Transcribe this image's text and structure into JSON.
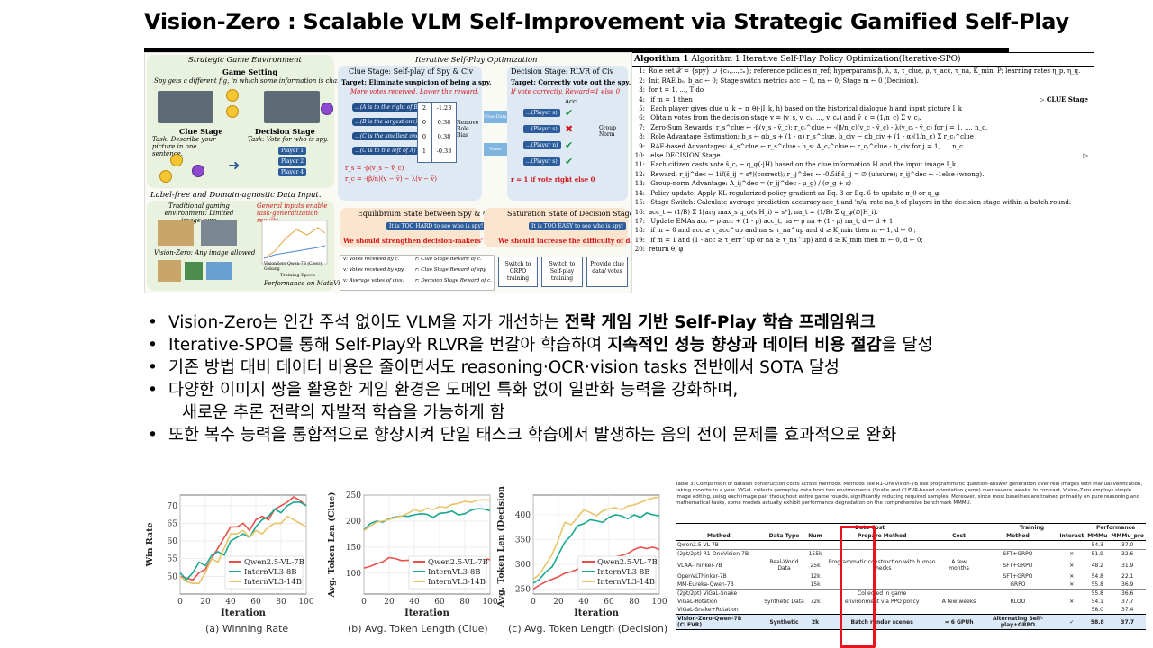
{
  "title": "Vision-Zero : Scalable VLM Self-Improvement via Strategic Gamified Self-Play",
  "framework": {
    "env_title": "Strategic Game Environment",
    "iter_title": "Iterative Self-Play Optimization",
    "game_setting": "Game Setting",
    "game_desc": "Spy gets a different fig, in which some information is changed.",
    "clue_stage_left": "Clue Stage",
    "clue_task": "Task: Describe your picture in one sentence.",
    "decision_stage_left": "Decision Stage",
    "decision_task": "Task: Vote for who is spy.",
    "player1": "Player 1",
    "player2": "Player 2",
    "player4": "Player 4",
    "label_free": "Label-free and Domain-agnostic Data Input.",
    "traditional": "Traditional gaming environment: Limited image type",
    "general": "General inputs enable task-generalization results",
    "any_image": "Vision-Zero: Any image allowed",
    "perf": "Performance on MathVision",
    "training_epoch": "Training Epoch",
    "legend1": "VisionZero-Qwen-7B (Clevr)",
    "legend2": "Gobang",
    "clue_stage_title": "Clue Stage: Self-play of Spy & Civ",
    "clue_target": "Target: Eliminate suspicion of being a spy.",
    "clue_red": "More votes received, Lower the reward.",
    "clues": [
      "...(A is to the right of B)",
      "...(B is the largest one)",
      "...(C is the smallest one)",
      "...(C is to the left of A)"
    ],
    "vc_vals": [
      "2",
      "0",
      "0",
      "1"
    ],
    "rc_vals": [
      "-1.23",
      "0.38",
      "0.38",
      "-0.33"
    ],
    "remove_bias": "Remove Role Bias",
    "clue_data": "Clue Data",
    "votes": "Votes",
    "decision_title": "Decision Stage: RLVR of Civ",
    "decision_target": "Target: Correctly vote out the spy.",
    "decision_red": "If vote correctly, Reward=1 else 0",
    "group_norm": "Group Norm",
    "players_right": [
      "...(Player s)",
      "...(Player s)",
      "...(Player n)",
      "...(Player s)"
    ],
    "acc_header": "Acc",
    "vote_formula": "r = 1 if vote right else 0",
    "eq_title": "Equilibrium State between Spy & Civ",
    "eq_msg": "It is TOO HARD to see who is spy!",
    "eq_red": "We should strengthen decision-makers' ability!",
    "sat_title": "Saturation State of Decision Stage",
    "sat_msg": "It is TOO EASY to see who is spy!",
    "sat_red": "We should increase the difficulty of data!",
    "legend_items": [
      "v: Votes received by c.",
      "r: Clue Stage Reward of c.",
      "v: Votes received by spy.",
      "r: Clue Stage Reward of spy.",
      "v: Average votes of civs.",
      "r: Decision Stage Reward of c."
    ],
    "switch1": "Switch to GRPO training",
    "switch2": "Switch to Self-play training",
    "switch3": "Provide clue data/ votes"
  },
  "algorithm": {
    "title": "Algorithm 1 Iterative Self-Play Policy Optimization(Iterative-SPO)",
    "clue_stage_tag": "▷ CLUE Stage",
    "decision_stage_tag": "▷",
    "lines": [
      {
        "n": "1:",
        "t": "Role set 𝒳 = {spy} ∪ {c₁,...,cₙ}; reference policies π_ref; hyperparams β, λ, α, τ_clue, ρ, τ_acc, τ_na, K_min, P; learning rates η_p, η_q."
      },
      {
        "n": "2:",
        "t": "Init RAE b₀, b_ac ← 0; Stage switch metrics acc ← 0, na ← 0; Stage m ← 0 (Decision)."
      },
      {
        "n": "3:",
        "t": "for t = 1, ..., T do"
      },
      {
        "n": "4:",
        "t": "    if m = 1 then"
      },
      {
        "n": "5:",
        "t": "        Each player gives clue u_k ~ π_θ(·|I_k, h) based on the historical dialogue h and input picture I_k"
      },
      {
        "n": "6:",
        "t": "        Obtain votes from the decision stage v = (v_s, v_c₁, ..., v_cₙ) and v̄_c = (1/n_c) Σ v_cⱼ."
      },
      {
        "n": "7:",
        "t": "        Zero-Sum Rewards: r_s^clue ← -β(v_s - v̄_c);  r_cⱼ^clue ← -(β/n_c)(v_c - v̄_c) - λ(v_cⱼ - v̄_c) for j = 1, ..., n_c."
      },
      {
        "n": "8:",
        "t": "        Role Advantage Estimation: b_s ← αb_s + (1 - α) r_s^clue,   b_civ ← αb_civ + (1 - α)(1/n_c) Σ r_cⱼ^clue"
      },
      {
        "n": "9:",
        "t": "        RAE-based Advantages: A_s^clue ← r_s^clue - b_s;   A_cⱼ^clue ← r_cⱼ^clue - b_civ for j = 1, ..., n_c."
      },
      {
        "n": "10:",
        "t": "    else DECISION Stage"
      },
      {
        "n": "11:",
        "t": "        Each citizen casts vote ŝ_cⱼ ~ q_φ(·|H) based on the clue information H and the input image I_k."
      },
      {
        "n": "12:",
        "t": "        Reward: r_ij^dec ← 1if(ŝ_ij = s*)(correct); r_ij^dec ← -0.5if ŝ_ij = ∅ (unsure); r_ij^dec ← -1else (wrong)."
      },
      {
        "n": "13:",
        "t": "        Group-norm Advantage: A_ij^dec = (r_ij^dec - μ_g) / (σ_g + ε)"
      },
      {
        "n": "14:",
        "t": "        Policy update: Apply KL-regularized policy gradient as Eq. 3 or Eq. 6 to update π_θ or q_φ."
      },
      {
        "n": "15:",
        "t": "        Stage Switch: Calculate average prediction accuracy acc_t and 'n/a' rate na_t of players in the decision stage within a batch round:"
      },
      {
        "n": "16:",
        "t": "acc_t = (1/B) Σ 1[arg max_s q_φ(s|H_i) = s*], na_t = (1/B) Σ q_φ(∅|H_i)."
      },
      {
        "n": "17:",
        "t": "    Update EMAs acc ← ρ acc + (1 - ρ) acc_t,  na ← ρ na + (1 - ρ) na_t, d ← d + 1."
      },
      {
        "n": "18:",
        "t": "    if m = 0 and acc ≥ τ_acc^up and na ≤ τ_na^up and d ≥ K_min then m ← 1, d ← 0 ;"
      },
      {
        "n": "19:",
        "t": "    if m = 1 and (1 - acc ≥ τ_err^up or na ≥ τ_na^up) and d ≥ K_min then m ← 0, d ← 0;"
      },
      {
        "n": "20:",
        "t": "return θ, φ"
      }
    ]
  },
  "bullets": [
    {
      "pre": "Vision-Zero는 인간 주석 없이도 VLM을 자가 개선하는 ",
      "bold": "전략 게임 기반 Self-Play 학습 프레임워크",
      "post": ""
    },
    {
      "pre": "Iterative-SPO를 통해 Self-Play와 RLVR을 번갈아 학습하여 ",
      "bold": "지속적인 성능 향상과 데이터 비용 절감",
      "post": "을 달성"
    },
    {
      "pre": "기존 방법 대비 데이터 비용은 줄이면서도 reasoning·OCR·vision tasks 전반에서 SOTA 달성",
      "bold": "",
      "post": ""
    },
    {
      "pre": "다양한 이미지 쌍을 활용한 게임 환경은 도메인 특화 없이 일반화 능력을 강화하며,",
      "bold": "",
      "post": ""
    },
    {
      "pre": "새로운 추론 전략의 자발적 학습을 가능하게 함",
      "bold": "",
      "post": "",
      "cont": true
    },
    {
      "pre": "또한 복수 능력을 통합적으로 향상시켜 단일 태스크 학습에서 발생하는 음의 전이 문제를 효과적으로 완화",
      "bold": "",
      "post": ""
    }
  ],
  "bullet_glyph": "•",
  "colors": {
    "qwen": "#e8504a",
    "intern8": "#1aa890",
    "intern14": "#e8c46a",
    "highlight": "#e8141b"
  },
  "chart_data": [
    {
      "type": "line",
      "caption": "(a) Winning Rate",
      "xlabel": "Iteration",
      "ylabel": "Win Rate",
      "xlim": [
        0,
        100
      ],
      "ylim": [
        45,
        73
      ],
      "xticks": [
        0,
        20,
        40,
        60,
        80,
        100
      ],
      "yticks": [
        50,
        55,
        60,
        65,
        70
      ],
      "legend": "bottom-right",
      "series": [
        {
          "name": "Qwen2.5-VL-7B",
          "x": [
            0,
            5,
            10,
            15,
            20,
            25,
            30,
            35,
            40,
            45,
            50,
            55,
            60,
            65,
            70,
            75,
            80,
            85,
            90,
            95,
            100
          ],
          "y": [
            50,
            49.5,
            49,
            51,
            52,
            55,
            58,
            61,
            64,
            64,
            65,
            63,
            66,
            67,
            66,
            69,
            70,
            71,
            72.5,
            71.5,
            70
          ]
        },
        {
          "name": "InternVL3-8B",
          "x": [
            0,
            5,
            10,
            15,
            20,
            25,
            30,
            35,
            40,
            45,
            50,
            55,
            60,
            65,
            70,
            75,
            80,
            85,
            90,
            95,
            100
          ],
          "y": [
            51,
            49,
            51,
            54,
            53,
            56,
            57,
            56,
            60,
            61,
            62,
            61,
            64,
            66,
            67,
            69,
            68,
            70,
            71,
            71,
            70
          ]
        },
        {
          "name": "InternVL3-14B",
          "x": [
            0,
            5,
            10,
            15,
            20,
            25,
            30,
            35,
            40,
            45,
            50,
            55,
            60,
            65,
            70,
            75,
            80,
            85,
            90,
            95,
            100
          ],
          "y": [
            50,
            48.5,
            48,
            48,
            51,
            55,
            54,
            58,
            62,
            62,
            63,
            61,
            63,
            62,
            64,
            65,
            65,
            67,
            66,
            65,
            64
          ]
        }
      ]
    },
    {
      "type": "line",
      "caption": "(b) Avg. Token Length (Clue)",
      "xlabel": "Iteration",
      "ylabel": "Avg. Token Len (Clue)",
      "xlim": [
        0,
        100
      ],
      "ylim": [
        60,
        250
      ],
      "xticks": [
        0,
        20,
        40,
        60,
        80,
        100
      ],
      "yticks": [
        100,
        150,
        200,
        250
      ],
      "legend": "bottom-right",
      "series": [
        {
          "name": "Qwen2.5-VL-7B",
          "x": [
            0,
            5,
            10,
            15,
            20,
            25,
            30,
            35,
            40,
            45,
            50,
            55,
            60,
            65,
            70,
            75,
            80,
            85,
            90,
            95,
            100
          ],
          "y": [
            110,
            113,
            118,
            122,
            130,
            128,
            124,
            125,
            120,
            122,
            124,
            118,
            125,
            128,
            126,
            130,
            127,
            129,
            131,
            128,
            126
          ]
        },
        {
          "name": "InternVL3-8B",
          "x": [
            0,
            5,
            10,
            15,
            20,
            25,
            30,
            35,
            40,
            45,
            50,
            55,
            60,
            65,
            70,
            75,
            80,
            85,
            90,
            95,
            100
          ],
          "y": [
            183,
            195,
            200,
            198,
            205,
            208,
            210,
            209,
            212,
            214,
            213,
            207,
            215,
            216,
            219,
            212,
            214,
            221,
            224,
            223,
            220
          ]
        },
        {
          "name": "InternVL3-14B",
          "x": [
            0,
            5,
            10,
            15,
            20,
            25,
            30,
            35,
            40,
            45,
            50,
            55,
            60,
            65,
            70,
            75,
            80,
            85,
            90,
            95,
            100
          ],
          "y": [
            182,
            190,
            198,
            200,
            203,
            207,
            210,
            215,
            222,
            218,
            225,
            222,
            228,
            226,
            232,
            234,
            238,
            236,
            240,
            241,
            240
          ]
        }
      ]
    },
    {
      "type": "line",
      "caption": "(c) Avg. Token Length (Decision)",
      "xlabel": "Iteration",
      "ylabel": "Avg. Token Len (Decision)",
      "xlim": [
        0,
        100
      ],
      "ylim": [
        240,
        440
      ],
      "xticks": [
        0,
        20,
        40,
        60,
        80,
        100
      ],
      "yticks": [
        250,
        300,
        350,
        400
      ],
      "legend": "bottom-right",
      "series": [
        {
          "name": "Qwen2.5-VL-7B",
          "x": [
            0,
            5,
            10,
            15,
            20,
            25,
            30,
            35,
            40,
            45,
            50,
            55,
            60,
            65,
            70,
            75,
            80,
            85,
            90,
            95,
            100
          ],
          "y": [
            250,
            258,
            265,
            270,
            275,
            282,
            285,
            290,
            298,
            303,
            300,
            302,
            308,
            315,
            318,
            322,
            330,
            335,
            332,
            335,
            330
          ]
        },
        {
          "name": "InternVL3-8B",
          "x": [
            0,
            5,
            10,
            15,
            20,
            25,
            30,
            35,
            40,
            45,
            50,
            55,
            60,
            65,
            70,
            75,
            80,
            85,
            90,
            95,
            100
          ],
          "y": [
            262,
            270,
            285,
            295,
            320,
            345,
            358,
            378,
            382,
            390,
            388,
            385,
            395,
            400,
            398,
            392,
            400,
            395,
            404,
            400,
            398
          ]
        },
        {
          "name": "InternVL3-14B",
          "x": [
            0,
            5,
            10,
            15,
            20,
            25,
            30,
            35,
            40,
            45,
            50,
            55,
            60,
            65,
            70,
            75,
            80,
            85,
            90,
            95,
            100
          ],
          "y": [
            270,
            280,
            300,
            320,
            350,
            385,
            380,
            395,
            410,
            405,
            398,
            408,
            412,
            415,
            410,
            418,
            420,
            425,
            430,
            434,
            436
          ]
        }
      ]
    }
  ],
  "table": {
    "caption": "Table 3: Comparison of dataset construction costs across methods. Methods like R1-OneVision-7B use programmatic question-answer generation over real images with manual verification, taking months to a year. ViGaL collects gameplay data from two environments (Snake and CLEVR-based orientation game) over several weeks. In contrast, Vision-Zero employs simple image editing, using each image pair throughout entire game rounds, significantly reducing required samples. Moreover, since most baselines are trained primarily on pure reasoning and mathematical tasks, some models actually exhibit performance degradation on the comprehensive benchmark MMMU.",
    "group_headers": [
      "Data Cost",
      "Training",
      "Performance"
    ],
    "headers": [
      "Method",
      "Data Type",
      "Num",
      "Prepare Method",
      "Cost",
      "Method",
      "Interact",
      "MMMu",
      "MMMu_pro"
    ],
    "rows": [
      {
        "cells": [
          "Qwen2.5-VL-7B",
          "—",
          "—",
          "—",
          "—",
          "—",
          "—",
          "54.3",
          "37.0"
        ],
        "grp": true
      },
      {
        "cells": [
          "(2pt/2pt) R1-OneVision-7B",
          "",
          "155k",
          "",
          "",
          "SFT+GRPO",
          "✕",
          "51.9",
          "32.6"
        ],
        "grp": true
      },
      {
        "cells": [
          "VLAA-Thinker-7B",
          "Real-World Data",
          "25k",
          "Programmatic construction with human checks",
          "A few months",
          "SFT+GRPO",
          "✕",
          "48.2",
          "31.9"
        ]
      },
      {
        "cells": [
          "OpenVLThinker-7B",
          "",
          "12k",
          "",
          "",
          "SFT+GRPO",
          "✕",
          "54.8",
          "22.1"
        ]
      },
      {
        "cells": [
          "MM-Eureka-Qwen-7B",
          "",
          "15k",
          "",
          "",
          "GRPO",
          "✕",
          "55.8",
          "36.9"
        ]
      },
      {
        "cells": [
          "(2pt/2pt) ViGaL-Snake",
          "",
          "",
          "Collected in game",
          "",
          "",
          "",
          "55.8",
          "36.6"
        ],
        "grp": true
      },
      {
        "cells": [
          "ViGaL-Rotation",
          "Synthetic Data",
          "72k",
          "environment via PPO policy",
          "A few weeks",
          "RLOO",
          "✕",
          "54.1",
          "37.7"
        ]
      },
      {
        "cells": [
          "ViGaL-Snake+Rotation",
          "",
          "",
          "",
          "",
          "",
          "",
          "58.0",
          "37.4"
        ]
      },
      {
        "cells": [
          "Vision-Zero-Qwen-7B (CLEVR)",
          "Synthetic",
          "2k",
          "Batch render scenes",
          "≈ 6 GPUh",
          "Alternating Self-play+GRPO",
          "✓",
          "58.8",
          "37.7"
        ],
        "last": true
      }
    ]
  }
}
